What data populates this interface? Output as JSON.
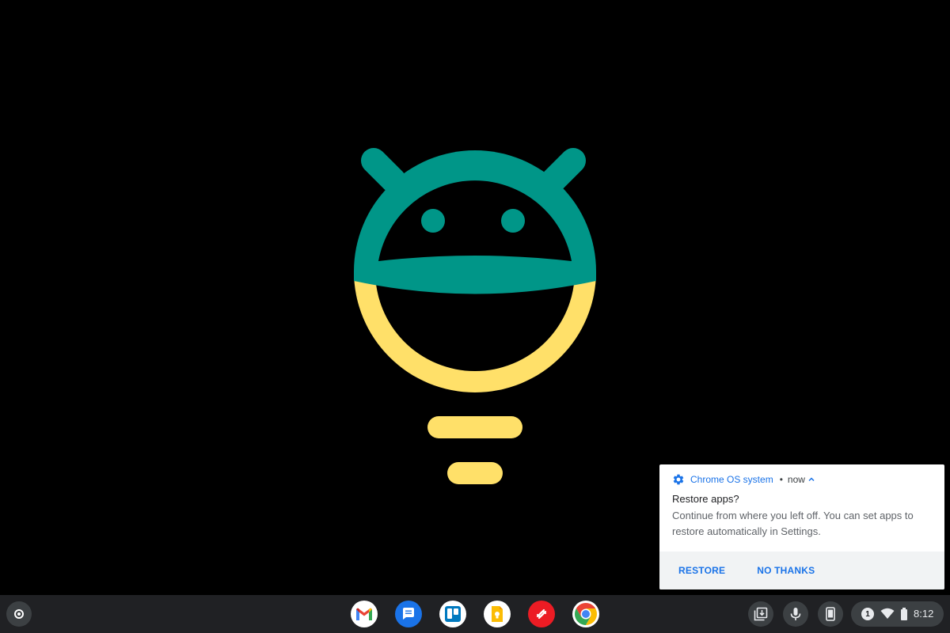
{
  "wallpaper": {
    "colors": {
      "teal": "#009688",
      "yellow": "#ffe069",
      "background": "#000000"
    }
  },
  "notification": {
    "app_icon": "gear-icon",
    "app_name": "Chrome OS system",
    "separator": "•",
    "time": "now",
    "title": "Restore apps?",
    "body": "Continue from where you left off. You can set apps to restore automatically in Settings.",
    "actions": {
      "restore": "RESTORE",
      "no_thanks": "NO THANKS"
    },
    "accent_color": "#1a73e8"
  },
  "shelf": {
    "launcher_icon": "launcher-circle-icon",
    "pinned_apps": [
      {
        "name": "Gmail",
        "icon": "gmail-icon"
      },
      {
        "name": "Messages",
        "icon": "messages-icon"
      },
      {
        "name": "Trello",
        "icon": "trello-icon"
      },
      {
        "name": "Google Keep",
        "icon": "keep-icon"
      },
      {
        "name": "Authy",
        "icon": "authy-icon"
      },
      {
        "name": "Chrome",
        "icon": "chrome-icon"
      }
    ],
    "tray": {
      "holding_space_icon": "holding-space-icon",
      "mic_icon": "mic-icon",
      "phone_hub_icon": "phone-icon",
      "notification_count": "1",
      "wifi_icon": "wifi-icon",
      "battery_icon": "battery-icon",
      "time": "8:12"
    }
  }
}
